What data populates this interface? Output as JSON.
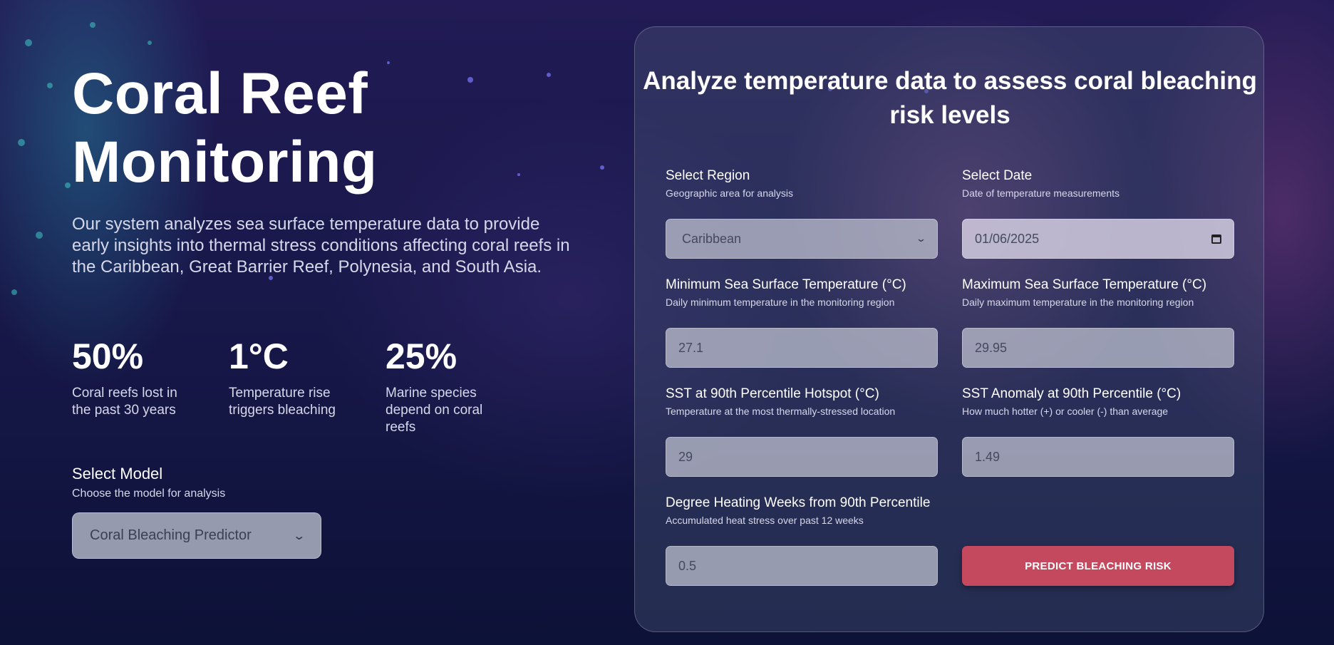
{
  "hero": {
    "title": "Coral Reef Monitoring",
    "description": "Our system analyzes sea surface temperature data to provide early insights into thermal stress conditions affecting coral reefs in the Caribbean, Great Barrier Reef, Polynesia, and South Asia."
  },
  "stats": [
    {
      "value": "50%",
      "label": "Coral reefs lost in the past 30 years"
    },
    {
      "value": "1°C",
      "label": "Temperature rise triggers bleaching"
    },
    {
      "value": "25%",
      "label": "Marine species depend on coral reefs"
    }
  ],
  "model": {
    "label": "Select Model",
    "help": "Choose the model for analysis",
    "selected": "Coral Bleaching Predictor"
  },
  "form": {
    "title": "Analyze temperature data to assess coral bleaching risk levels",
    "region": {
      "label": "Select Region",
      "help": "Geographic area for analysis",
      "value": "Caribbean"
    },
    "date": {
      "label": "Select Date",
      "help": "Date of temperature measurements",
      "value": "01/06/2025"
    },
    "min_sst": {
      "label": "Minimum Sea Surface Temperature (°C)",
      "help": "Daily minimum temperature in the monitoring region",
      "value": "27.1"
    },
    "max_sst": {
      "label": "Maximum Sea Surface Temperature (°C)",
      "help": "Daily maximum temperature in the monitoring region",
      "value": "29.95"
    },
    "sst_hotspot": {
      "label": "SST at 90th Percentile Hotspot (°C)",
      "help": "Temperature at the most thermally-stressed location",
      "value": "29"
    },
    "sst_anomaly": {
      "label": "SST Anomaly at 90th Percentile (°C)",
      "help": "How much hotter (+) or cooler (-) than average",
      "value": "1.49"
    },
    "dhw": {
      "label": "Degree Heating Weeks from 90th Percentile",
      "help": "Accumulated heat stress over past 12 weeks",
      "value": "0.5"
    },
    "submit_label": "PREDICT BLEACHING RISK"
  },
  "colors": {
    "accent": "#c4485e",
    "background": "#18184a"
  }
}
